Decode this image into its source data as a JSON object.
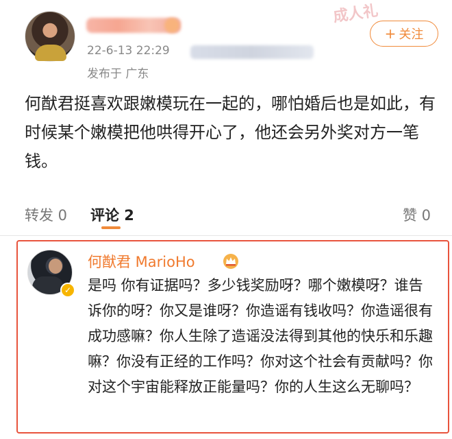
{
  "post": {
    "timestamp": "22-6-13 22:29",
    "location": "发布于 广东",
    "follow_label": "关注",
    "body": "何猷君挺喜欢跟嫩模玩在一起的，哪怕婚后也是如此，有时候某个嫩模把他哄得开心了，他还会另外奖对方一笔钱。",
    "corner_stamp": "成人礼"
  },
  "actions": {
    "repost": "转发 0",
    "comments": "评论 2",
    "likes": "赞 0"
  },
  "comment": {
    "author": "何猷君 MarioHo",
    "text": "是吗 你有证据吗？多少钱奖励呀？哪个嫩模呀？谁告诉你的呀？你又是谁呀？你造谣有钱收吗？你造谣很有成功感嘛？你人生除了造谣没法得到其他的快乐和乐趣嘛？你没有正经的工作吗？你对这个社会有贡献吗？你对这个宇宙能释放正能量吗？你的人生这么无聊吗？"
  },
  "icons": {
    "plus": "plus-icon",
    "crown": "crown-icon",
    "verified": "verified-icon"
  },
  "colors": {
    "accent": "#f08a3a",
    "highlight_border": "#e8533c",
    "author_name": "#f07a2e"
  }
}
